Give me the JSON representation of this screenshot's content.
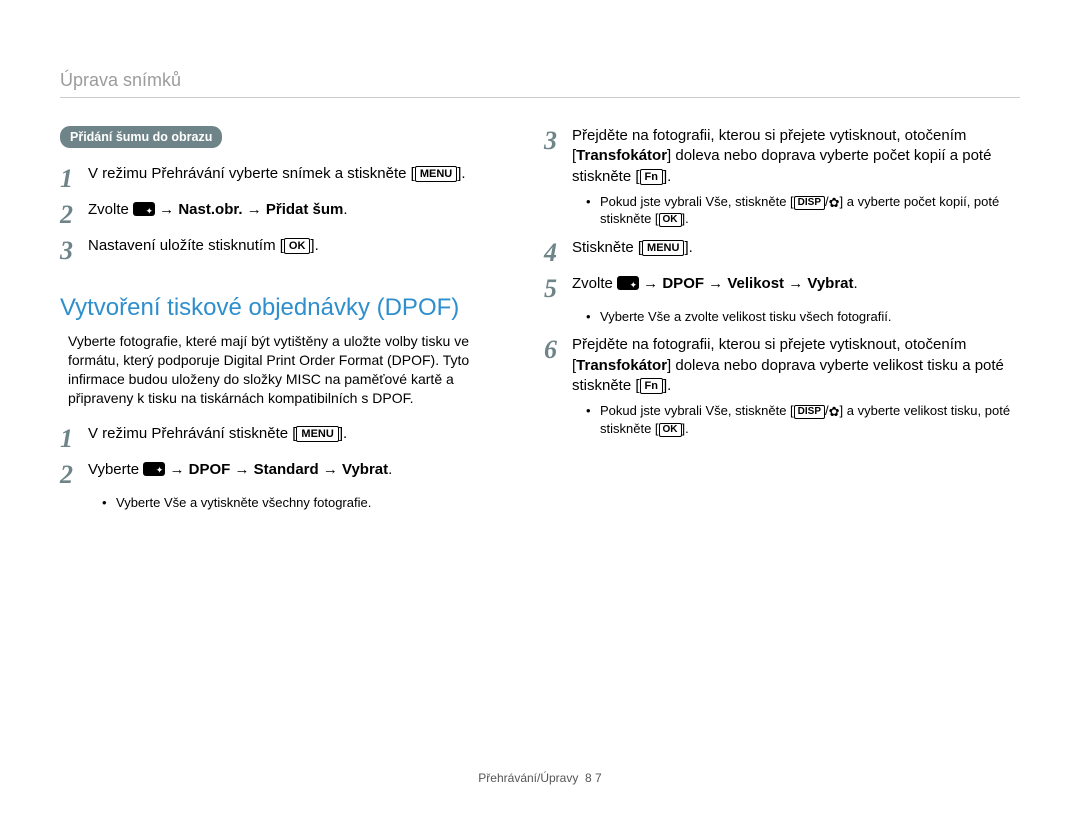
{
  "header": "Úprava snímků",
  "pill": "Přidání šumu do obrazu",
  "kbd_menu": "MENU",
  "kbd_ok": "OK",
  "kbd_fn": "Fn",
  "kbd_disp": "DISP",
  "left": {
    "s1": {
      "n": "1",
      "a": "V režimu Přehrávání vyberte snímek a stiskněte [",
      "b": "]."
    },
    "s2": {
      "n": "2",
      "a": "Zvolte ",
      "b": " → Nast.obr. → Přidat šum",
      "c": "."
    },
    "s3": {
      "n": "3",
      "a": "Nastavení uložíte stisknutím [",
      "b": "]."
    },
    "h2": "Vytvoření tiskové objednávky (DPOF)",
    "para": "Vyberte fotografie, které mají být vytištěny a uložte volby tisku ve formátu, který podporuje Digital Print Order Format (DPOF). Tyto infirmace budou uloženy do složky MISC na paměťové kartě a připraveny k tisku na tiskárnách kompatibilních s DPOF.",
    "s4": {
      "n": "1",
      "a": "V režimu Přehrávání stiskněte [",
      "b": "]."
    },
    "s5": {
      "n": "2",
      "a": "Vyberte ",
      "b": " → DPOF → Standard → Vybrat",
      "c": "."
    },
    "sub1": {
      "a": "Vyberte ",
      "b": "Vše",
      "c": " a vytiskněte všechny fotografie."
    }
  },
  "right": {
    "s3": {
      "n": "3",
      "a": "Přejděte na fotografii, kterou si přejete vytisknout, otočením [",
      "b": "Transfokátor",
      "c": "] doleva nebo doprava vyberte počet kopií a poté stiskněte [",
      "d": "]."
    },
    "sub_r1": {
      "a": "Pokud jste vybrali ",
      "b": "Vše",
      "c": ", stiskněte [",
      "d": "/",
      "e": "] a vyberte počet kopií, poté stiskněte [",
      "f": "]."
    },
    "s4": {
      "n": "4",
      "a": "Stiskněte [",
      "b": "]."
    },
    "s5": {
      "n": "5",
      "a": "Zvolte ",
      "b": " → DPOF → Velikost → Vybrat",
      "c": "."
    },
    "sub_r2": {
      "a": "Vyberte ",
      "b": "Vše",
      "c": " a zvolte velikost tisku všech fotografií."
    },
    "s6": {
      "n": "6",
      "a": "Přejděte na fotografii, kterou si přejete vytisknout, otočením [",
      "b": "Transfokátor",
      "c": "] doleva nebo doprava vyberte velikost tisku a poté stiskněte [",
      "d": "]."
    },
    "sub_r3": {
      "a": "Pokud jste vybrali ",
      "b": "Vše",
      "c": ", stiskněte [",
      "d": "/",
      "e": "] a vyberte velikost tisku, poté stiskněte [",
      "f": "]."
    }
  },
  "footer": {
    "a": "Přehrávání/Úpravy",
    "b": "8 7"
  }
}
